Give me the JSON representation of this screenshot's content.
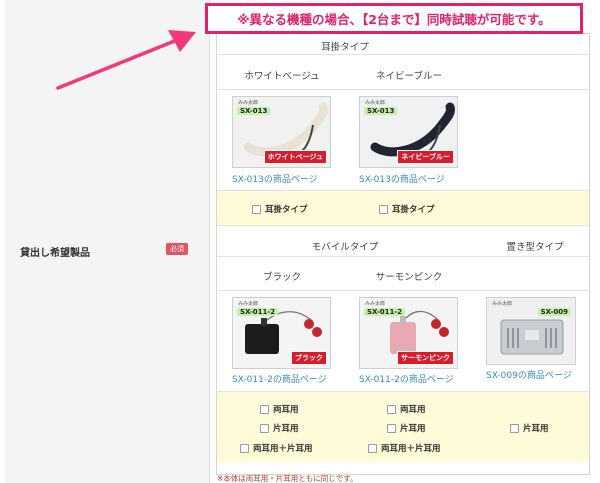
{
  "callout": {
    "text": "※異なる機種の場合、【2台まで】同時試聴が可能です。"
  },
  "form_row": {
    "label": "貸出し希望製品",
    "required_badge": "必須"
  },
  "sections": {
    "ear_hook": {
      "header": "耳掛タイプ",
      "colors": [
        "ホワイトベージュ",
        "ネイビーブルー"
      ],
      "images": [
        {
          "brand": "みみ太郎",
          "model": "SX-013",
          "tag": "ホワイトベージュ"
        },
        {
          "brand": "みみ太郎",
          "model": "SX-013",
          "tag": "ネイビーブルー"
        }
      ],
      "links": [
        "SX-013の商品ページ",
        "SX-013の商品ページ"
      ],
      "checkboxes": [
        "耳掛タイプ",
        "耳掛タイプ"
      ]
    },
    "mobile": {
      "header": "モバイルタイプ",
      "colors": [
        "ブラック",
        "サーモンピンク"
      ],
      "images": [
        {
          "brand": "みみ太郎",
          "model": "SX-011-2",
          "tag": "ブラック"
        },
        {
          "brand": "みみ太郎",
          "model": "SX-011-2",
          "tag": "サーモンピンク"
        }
      ],
      "links": [
        "SX-011-2の商品ページ",
        "SX-011-2の商品ページ"
      ],
      "options": [
        "両耳用",
        "片耳用",
        "両耳用＋片耳用"
      ]
    },
    "desktop": {
      "header": "置き型タイプ",
      "image": {
        "brand": "みみ太郎",
        "model": "SX-009"
      },
      "link": "SX-009の商品ページ",
      "options": [
        "片耳用"
      ]
    }
  },
  "footnote": "※本体は両耳用・片耳用ともに同じです。",
  "colors": {
    "accent": "#e0226e",
    "link": "#3b88c4",
    "yellow_bg": "#fffbd8",
    "badge": "#e05561"
  }
}
